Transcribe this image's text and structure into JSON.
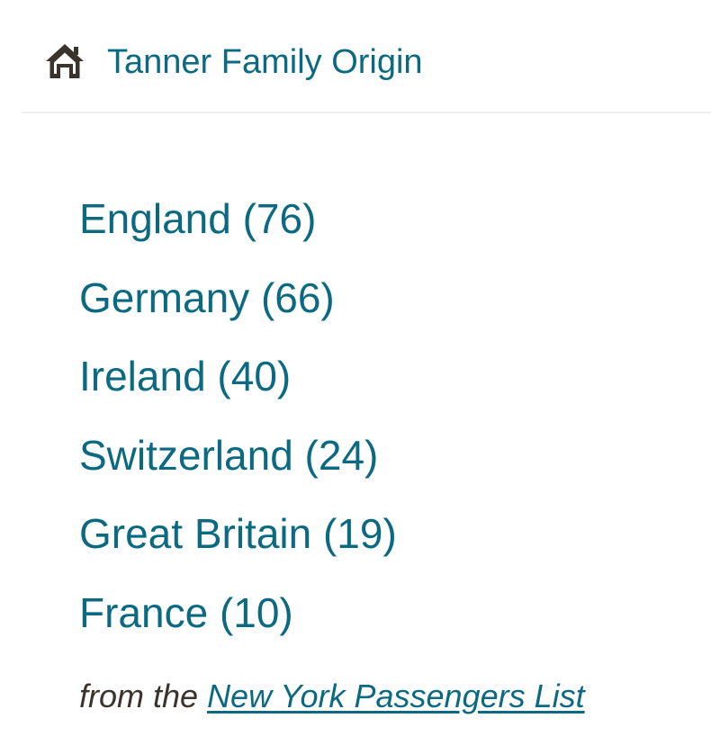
{
  "header": {
    "icon": "home-icon",
    "title": "Tanner Family Origin"
  },
  "origins": [
    {
      "label": "England (76)"
    },
    {
      "label": "Germany (66)"
    },
    {
      "label": "Ireland (40)"
    },
    {
      "label": "Switzerland (24)"
    },
    {
      "label": "Great Britain (19)"
    },
    {
      "label": "France (10)"
    }
  ],
  "footer": {
    "prefix": "from the ",
    "link_text": "New York Passengers List"
  },
  "colors": {
    "link": "#0b6a82",
    "icon": "#3a342c",
    "divider": "#eeeeee"
  }
}
